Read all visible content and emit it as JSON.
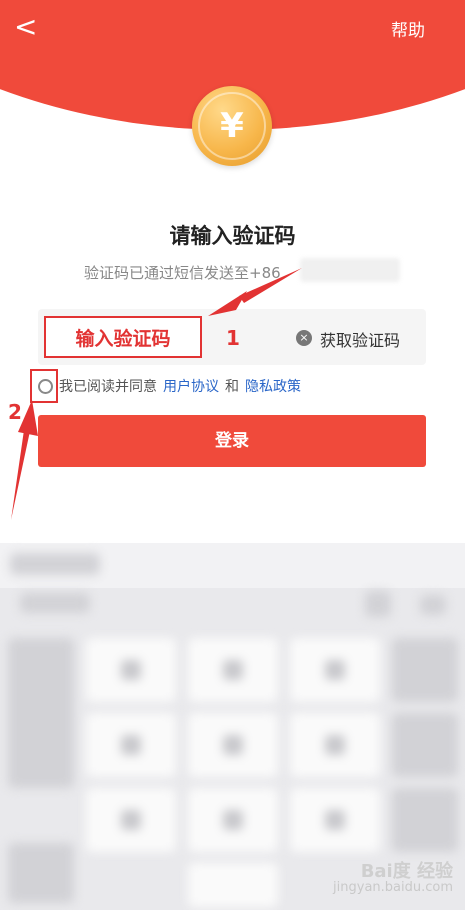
{
  "header": {
    "back_glyph": "<",
    "help_label": "帮助"
  },
  "coin": {
    "symbol": "¥"
  },
  "page": {
    "title": "请输入验证码",
    "subtitle": "验证码已通过短信发送至+86"
  },
  "code_field": {
    "placeholder": "输入验证码",
    "clear_icon": "×"
  },
  "get_code_label": "获取验证码",
  "agreement": {
    "prefix": "我已阅读并同意",
    "user_agreement": "用户协议",
    "and": "和",
    "privacy_policy": "隐私政策"
  },
  "login_label": "登录",
  "annotations": {
    "step1": "1",
    "step2": "2"
  },
  "watermark": {
    "brand": "Bai度 经验",
    "url": "jingyan.baidu.com"
  },
  "colors": {
    "brand_red": "#f04a3b",
    "annotation_red": "#e23333",
    "link_blue": "#2a66c8"
  }
}
